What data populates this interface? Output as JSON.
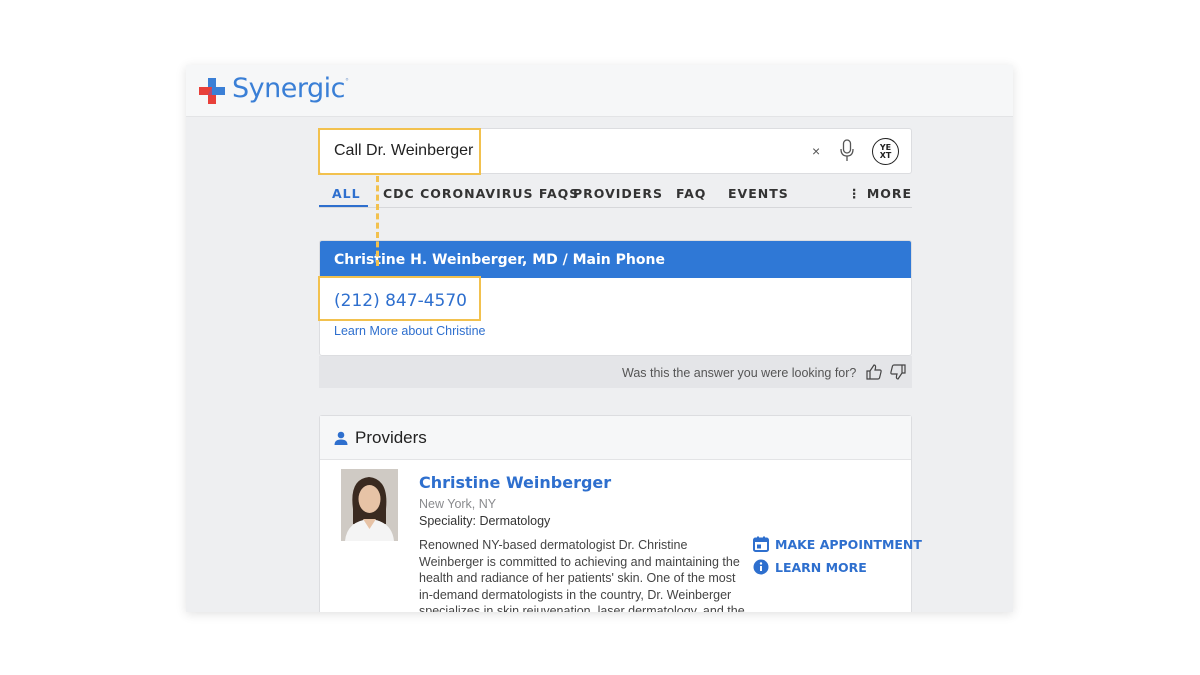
{
  "brand": {
    "name": "Synergic",
    "trademark": "°"
  },
  "search": {
    "query": "Call Dr. Weinberger",
    "clear_label": "×",
    "assistant_badge": "YE\nXT"
  },
  "tabs": [
    {
      "label": "ALL",
      "active": true
    },
    {
      "label": "CDC CORONAVIRUS FAQS"
    },
    {
      "label": "PROVIDERS"
    },
    {
      "label": "FAQ"
    },
    {
      "label": "EVENTS"
    },
    {
      "label": "⋮ MORE"
    }
  ],
  "answer": {
    "heading": "Christine H. Weinberger, MD / Main Phone",
    "phone": "(212) 847-4570",
    "link": "Learn More about Christine",
    "feedback": "Was this the answer you were looking for?"
  },
  "providers": {
    "title": "Providers",
    "items": [
      {
        "name": "Christine Weinberger",
        "location": "New York, NY",
        "speciality": "Speciality: Dermatology",
        "description": "Renowned NY-based dermatologist Dr. Christine Weinberger is committed to achieving and maintaining the health and radiance of her patients' skin. One of the most in-demand dermatologists in the country, Dr. Weinberger specializes in skin rejuvenation, laser dermatology, and the link between",
        "actions": [
          "MAKE APPOINTMENT",
          "LEARN MORE"
        ]
      }
    ]
  },
  "colors": {
    "accent": "#2e6fce",
    "header_blue": "#2f78d6",
    "highlight": "#f2c14e",
    "logo_red": "#e8403a"
  }
}
